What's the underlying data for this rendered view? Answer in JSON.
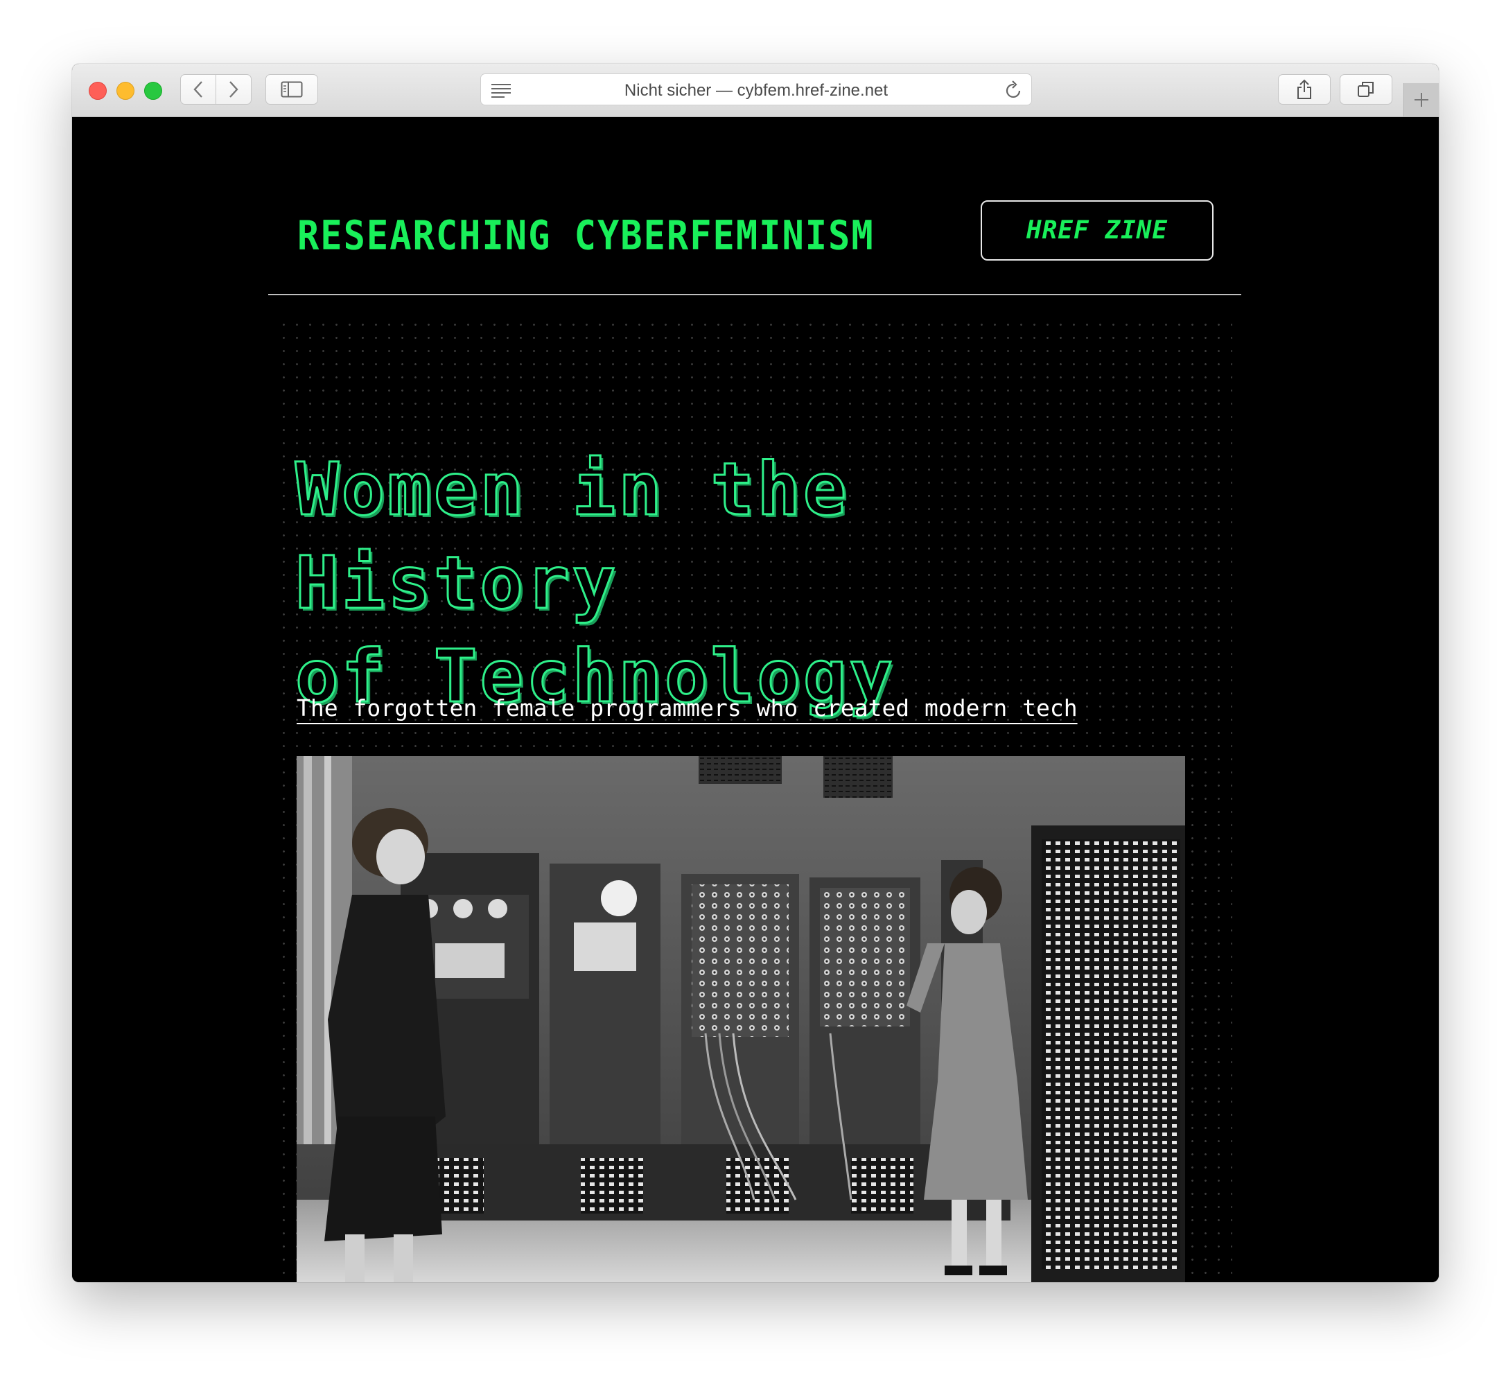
{
  "browser": {
    "address": "Nicht sicher — cybfem.href-zine.net"
  },
  "site": {
    "title": "RESEARCHING CYBERFEMINISM",
    "zine_button": "HREF ZINE"
  },
  "article": {
    "headline_line1": "Women in the History",
    "headline_line2": "of Technology",
    "subtitle": "The forgotten female programmers who created modern tech"
  },
  "colors": {
    "accent_green": "#19f05a",
    "headline_green": "#2ef08a",
    "background": "#000000"
  }
}
